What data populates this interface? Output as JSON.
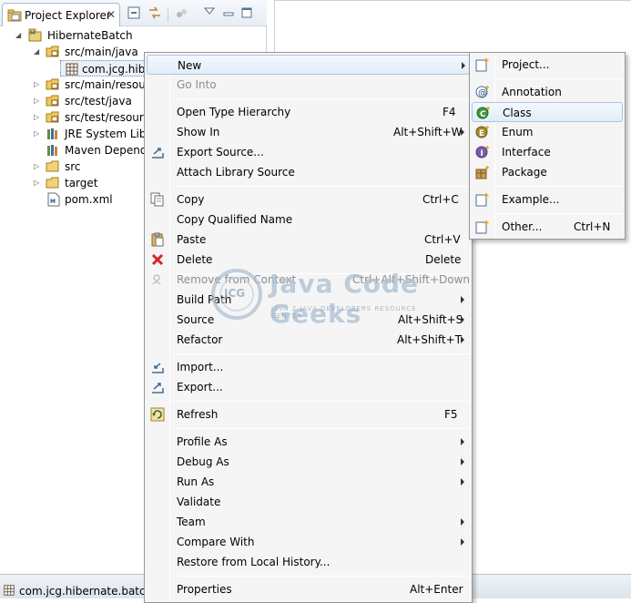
{
  "explorer": {
    "tab_label": "Project Explorer",
    "tree": [
      {
        "label": "HibernateBatch",
        "icon": "maven-project-icon"
      },
      {
        "label": "src/main/java",
        "icon": "source-folder-icon"
      },
      {
        "label": "com.jcg.hibe",
        "icon": "package-icon"
      },
      {
        "label": "src/main/resour",
        "icon": "source-folder-icon"
      },
      {
        "label": "src/test/java",
        "icon": "source-folder-icon"
      },
      {
        "label": "src/test/resource",
        "icon": "source-folder-icon"
      },
      {
        "label": "JRE System Libra",
        "icon": "library-icon"
      },
      {
        "label": "Maven Depende",
        "icon": "library-icon"
      },
      {
        "label": "src",
        "icon": "folder-icon"
      },
      {
        "label": "target",
        "icon": "folder-icon"
      },
      {
        "label": "pom.xml",
        "icon": "xml-file-icon"
      }
    ]
  },
  "status_bar": {
    "text": "com.jcg.hibernate.batch.p"
  },
  "context_menu": {
    "items": [
      {
        "label": "New",
        "shortcut": "",
        "submenu": true
      },
      {
        "label": "Go Into",
        "shortcut": "",
        "disabled": true
      },
      {
        "label": "Open Type Hierarchy",
        "shortcut": "F4"
      },
      {
        "label": "Show In",
        "shortcut": "Alt+Shift+W",
        "submenu": true
      },
      {
        "label": "Export Source...",
        "shortcut": ""
      },
      {
        "label": "Attach Library Source",
        "shortcut": ""
      },
      {
        "label": "Copy",
        "shortcut": "Ctrl+C"
      },
      {
        "label": "Copy Qualified Name",
        "shortcut": ""
      },
      {
        "label": "Paste",
        "shortcut": "Ctrl+V"
      },
      {
        "label": "Delete",
        "shortcut": "Delete"
      },
      {
        "label": "Remove from Context",
        "shortcut": "Ctrl+Alt+Shift+Down",
        "disabled": true
      },
      {
        "label": "Build Path",
        "shortcut": "",
        "submenu": true
      },
      {
        "label": "Source",
        "shortcut": "Alt+Shift+S",
        "submenu": true
      },
      {
        "label": "Refactor",
        "shortcut": "Alt+Shift+T",
        "submenu": true
      },
      {
        "label": "Import...",
        "shortcut": ""
      },
      {
        "label": "Export...",
        "shortcut": ""
      },
      {
        "label": "Refresh",
        "shortcut": "F5"
      },
      {
        "label": "Profile As",
        "shortcut": "",
        "submenu": true
      },
      {
        "label": "Debug As",
        "shortcut": "",
        "submenu": true
      },
      {
        "label": "Run As",
        "shortcut": "",
        "submenu": true
      },
      {
        "label": "Validate",
        "shortcut": ""
      },
      {
        "label": "Team",
        "shortcut": "",
        "submenu": true
      },
      {
        "label": "Compare With",
        "shortcut": "",
        "submenu": true
      },
      {
        "label": "Restore from Local History...",
        "shortcut": ""
      },
      {
        "label": "Properties",
        "shortcut": "Alt+Enter"
      }
    ]
  },
  "submenu": {
    "items": [
      {
        "label": "Project...",
        "shortcut": ""
      },
      {
        "label": "Annotation",
        "shortcut": ""
      },
      {
        "label": "Class",
        "shortcut": "",
        "highlighted": true
      },
      {
        "label": "Enum",
        "shortcut": ""
      },
      {
        "label": "Interface",
        "shortcut": ""
      },
      {
        "label": "Package",
        "shortcut": ""
      },
      {
        "label": "Example...",
        "shortcut": ""
      },
      {
        "label": "Other...",
        "shortcut": "Ctrl+N"
      }
    ]
  },
  "watermark": {
    "title": "Java Code Geeks",
    "subtitle": "JAVA 2 JAVA DEVELOPERS RESOURCE CENTER",
    "logo_text": "JCG"
  },
  "colors": {
    "highlight_border": "#a8c6e6",
    "menu_bg": "#f5f5f5",
    "delete_red": "#d4242b"
  }
}
